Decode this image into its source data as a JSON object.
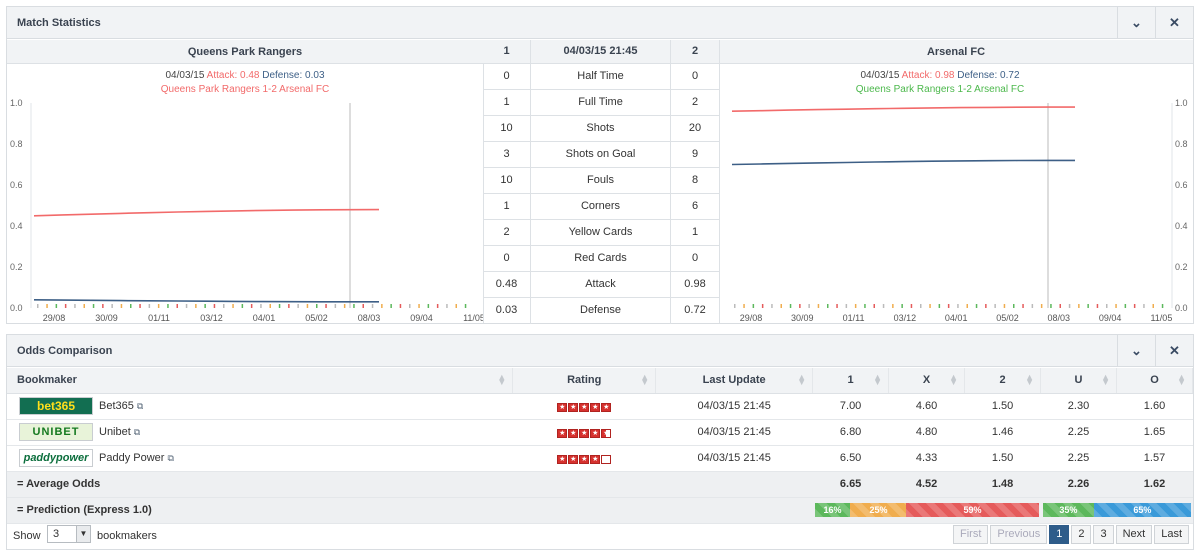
{
  "match_stats": {
    "title": "Match Statistics",
    "collapse_icon": "chevron-down-icon",
    "close_icon": "close-icon",
    "home_team": "Queens Park Rangers",
    "away_team": "Arsenal FC",
    "header": {
      "home": "1",
      "date": "04/03/15 21:45",
      "away": "2"
    },
    "rows": [
      {
        "home": "0",
        "label": "Half Time",
        "away": "0"
      },
      {
        "home": "1",
        "label": "Full Time",
        "away": "2"
      },
      {
        "home": "10",
        "label": "Shots",
        "away": "20"
      },
      {
        "home": "3",
        "label": "Shots on Goal",
        "away": "9"
      },
      {
        "home": "10",
        "label": "Fouls",
        "away": "8"
      },
      {
        "home": "1",
        "label": "Corners",
        "away": "6"
      },
      {
        "home": "2",
        "label": "Yellow Cards",
        "away": "1"
      },
      {
        "home": "0",
        "label": "Red Cards",
        "away": "0"
      },
      {
        "home": "0.48",
        "label": "Attack",
        "away": "0.98"
      },
      {
        "home": "0.03",
        "label": "Defense",
        "away": "0.72"
      }
    ],
    "home_caption": {
      "date": "04/03/15",
      "attack_label": "Attack: 0.48",
      "defense_label": "Defense: 0.03",
      "result": "Queens Park Rangers 1-2 Arsenal FC"
    },
    "away_caption": {
      "date": "04/03/15",
      "attack_label": "Attack: 0.98",
      "defense_label": "Defense: 0.72",
      "result": "Queens Park Rangers 1-2 Arsenal FC"
    }
  },
  "chart_data": [
    {
      "type": "line",
      "title": "Queens Park Rangers",
      "xlabel": "",
      "ylabel": "",
      "x_ticks": [
        "29/08",
        "30/09",
        "01/11",
        "03/12",
        "04/01",
        "05/02",
        "08/03",
        "09/04",
        "11/05"
      ],
      "y_ticks": [
        "0.0",
        "0.2",
        "0.4",
        "0.6",
        "0.8",
        "1.0"
      ],
      "ylim": [
        0,
        1
      ],
      "series": [
        {
          "name": "Attack",
          "color": "#f26a6a",
          "x": [
            "29/08",
            "08/03"
          ],
          "values": [
            0.45,
            0.48
          ]
        },
        {
          "name": "Defense",
          "color": "#3d5f86",
          "x": [
            "29/08",
            "08/03"
          ],
          "values": [
            0.04,
            0.03
          ]
        }
      ],
      "marker_date": "04/03/15"
    },
    {
      "type": "line",
      "title": "Arsenal FC",
      "xlabel": "",
      "ylabel": "",
      "x_ticks": [
        "29/08",
        "30/09",
        "01/11",
        "03/12",
        "04/01",
        "05/02",
        "08/03",
        "09/04",
        "11/05"
      ],
      "y_ticks": [
        "0.0",
        "0.2",
        "0.4",
        "0.6",
        "0.8",
        "1.0"
      ],
      "ylim": [
        0,
        1
      ],
      "series": [
        {
          "name": "Attack",
          "color": "#f26a6a",
          "x": [
            "29/08",
            "08/03"
          ],
          "values": [
            0.96,
            0.98
          ]
        },
        {
          "name": "Defense",
          "color": "#3d5f86",
          "x": [
            "29/08",
            "08/03"
          ],
          "values": [
            0.7,
            0.72
          ]
        }
      ],
      "marker_date": "04/03/15"
    }
  ],
  "odds": {
    "title": "Odds Comparison",
    "collapse_icon": "chevron-down-icon",
    "close_icon": "close-icon",
    "columns": [
      "Bookmaker",
      "Rating",
      "Last Update",
      "1",
      "X",
      "2",
      "U",
      "O"
    ],
    "bookmakers": [
      {
        "logo": "bet365",
        "name": "Bet365",
        "rating": 5,
        "updated": "04/03/15 21:45",
        "o1": "7.00",
        "ox": "4.60",
        "o2": "1.50",
        "u": "2.30",
        "o": "1.60"
      },
      {
        "logo": "UNIBET",
        "name": "Unibet",
        "rating": 4.5,
        "updated": "04/03/15 21:45",
        "o1": "6.80",
        "ox": "4.80",
        "o2": "1.46",
        "u": "2.25",
        "o": "1.65"
      },
      {
        "logo": "paddypower",
        "name": "Paddy Power",
        "rating": 4,
        "updated": "04/03/15 21:45",
        "o1": "6.50",
        "ox": "4.33",
        "o2": "1.50",
        "u": "2.25",
        "o": "1.57"
      }
    ],
    "average": {
      "label": "= Average Odds",
      "o1": "6.65",
      "ox": "4.52",
      "o2": "1.48",
      "u": "2.26",
      "o": "1.62"
    },
    "prediction": {
      "label": "= Prediction (Express 1.0)",
      "result": [
        {
          "label": "16%",
          "value": 16,
          "color": "#5cb85c"
        },
        {
          "label": "25%",
          "value": 25,
          "color": "#f0ad4e"
        },
        {
          "label": "59%",
          "value": 59,
          "color": "#e55b5b"
        }
      ],
      "goals": [
        {
          "label": "35%",
          "value": 35,
          "color": "#5cb85c"
        },
        {
          "label": "65%",
          "value": 65,
          "color": "#3a9ad9"
        }
      ]
    },
    "show_label": "Show",
    "show_value": "3",
    "bookmakers_label": "bookmakers",
    "pager": {
      "first": "First",
      "previous": "Previous",
      "pages": [
        "1",
        "2",
        "3"
      ],
      "active": "1",
      "next": "Next",
      "last": "Last"
    }
  }
}
